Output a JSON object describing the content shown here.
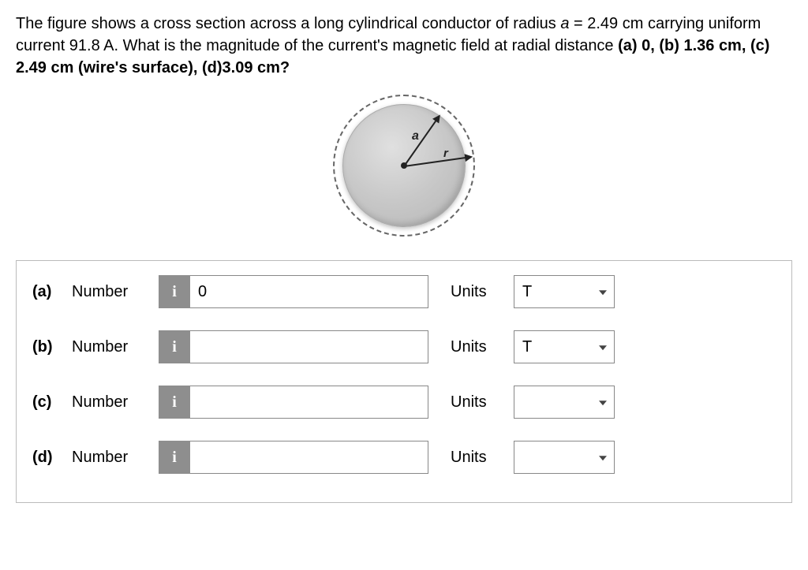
{
  "question": {
    "pre": "The figure shows a cross section across a long cylindrical conductor of radius ",
    "radius_var": "a",
    "eq": " = 2.49 cm carrying uniform current 91.8 A. What is the magnitude of the current's magnetic field at radial distance ",
    "parts_text": "(a) 0, (b) 1.36 cm, (c) 2.49 cm (wire's surface), (d)3.09 cm?"
  },
  "figure": {
    "label_a": "a",
    "label_r": "r"
  },
  "labels": {
    "number": "Number",
    "units": "Units",
    "info": "i"
  },
  "rows": [
    {
      "part": "(a)",
      "value": "0",
      "unit": "T"
    },
    {
      "part": "(b)",
      "value": "",
      "unit": "T"
    },
    {
      "part": "(c)",
      "value": "",
      "unit": ""
    },
    {
      "part": "(d)",
      "value": "",
      "unit": ""
    }
  ]
}
